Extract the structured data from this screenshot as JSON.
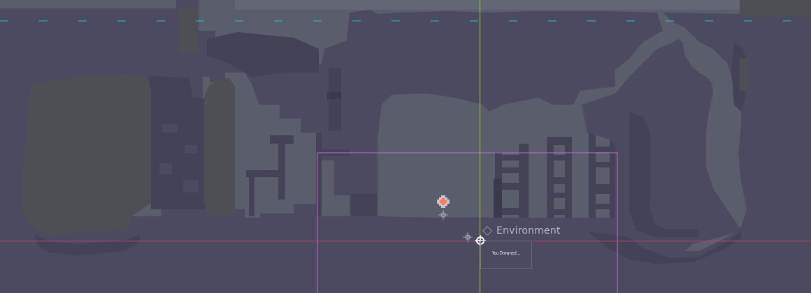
{
  "editor": {
    "node_label": "Environment",
    "message_text": "You Drowned...",
    "icons": [
      "environment-node-icon",
      "player-spawn-icon",
      "pivot-handle-icon"
    ]
  },
  "colors": {
    "background": "#5a5e6c",
    "wall": "#4b4a60",
    "wall_dark": "#434257",
    "wall_deep": "#3b3a4d",
    "platform_olive": "#4e4f54",
    "x_axis": "#cf3d6a",
    "y_axis": "#9ccf3a",
    "selection_rect": "#c66ad6",
    "limit_line": "#2fb8d8",
    "spawn_accent": "#ff7a55"
  }
}
